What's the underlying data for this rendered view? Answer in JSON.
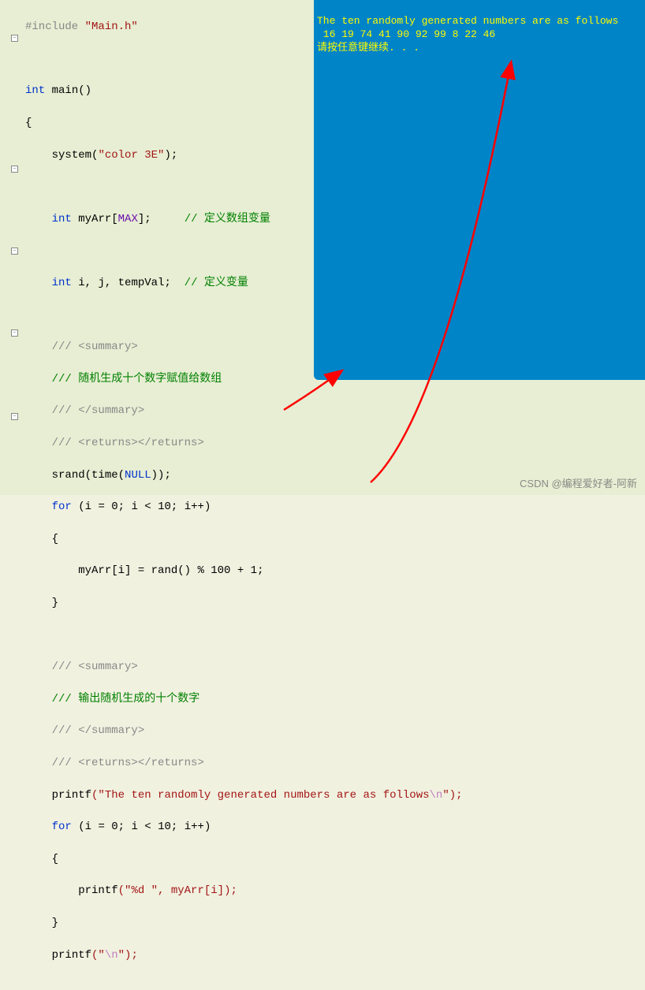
{
  "code": {
    "include_directive": "#include",
    "include_file": "\"Main.h\"",
    "main_type": "int",
    "main_name": "main",
    "lbrace": "{",
    "rbrace": "}",
    "system_call": "system",
    "system_arg": "\"color 3E\"",
    "int_kw": "int",
    "arr_name": "myArr",
    "max_macro": "MAX",
    "comment_arr": "// 定义数组变量",
    "vars_decl": "i, j, tempVal;",
    "comment_var": "// 定义变量",
    "doc_summary_open": "/// <summary>",
    "doc_line1": "/// 随机生成十个数字赋值给数组",
    "doc_summary_close": "/// </summary>",
    "doc_returns": "/// <returns></returns>",
    "srand_call": "srand",
    "time_call": "time",
    "null_kw": "NULL",
    "for_kw": "for",
    "for_cond": "(i = 0; i < 10; i++)",
    "rand_call": "rand",
    "rand_expr_pre": "myArr[i] = ",
    "rand_expr_post": "() % 100 + 1;",
    "doc_line2": "/// 输出随机生成的十个数字",
    "printf_call": "printf",
    "printf_msg_pre": "(\"The ten randomly generated numbers are as follows",
    "printf_msg_esc": "\\n",
    "printf_msg_post": "\");",
    "printf_fmt": "(\"%d \", myArr[i]);",
    "printf_nl_pre": "(\"",
    "printf_nl_esc": "\\n",
    "printf_nl_post": "\");",
    "lt": "<",
    "eq": "=",
    "zero": "0",
    "ten": "10",
    "pp": "++",
    "i": "i",
    "semi": ";"
  },
  "console": {
    "line1": "The ten randomly generated numbers are as follows",
    "line2": " 16 19 74 41 90 92 99 8 22 46",
    "line3": "请按任意键继续. . ."
  },
  "watermark": "CSDN @编程爱好者-阿新",
  "colors": {
    "console_bg": "#0084c8",
    "console_fg": "#fffb00",
    "arrow": "#ff0000"
  }
}
